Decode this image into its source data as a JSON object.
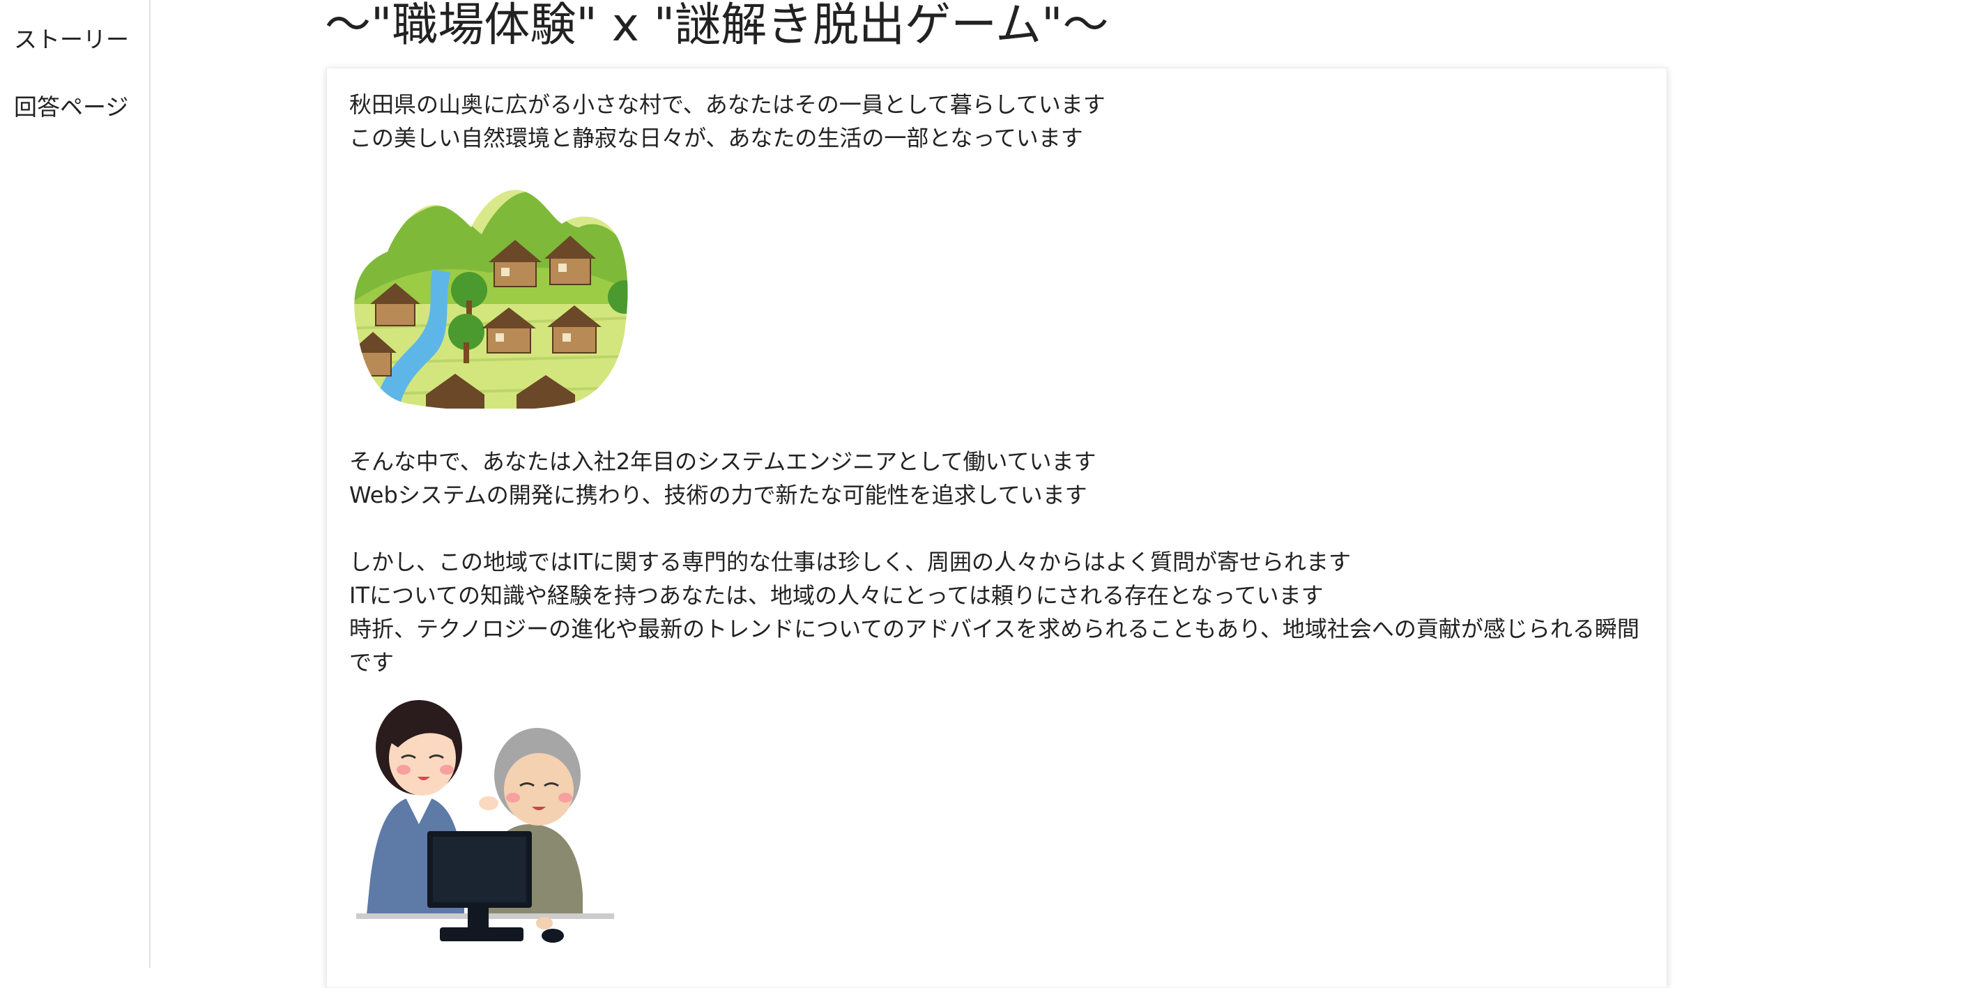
{
  "sidebar": {
    "items": [
      {
        "label": "ストーリー"
      },
      {
        "label": "回答ページ"
      }
    ]
  },
  "header": {
    "title": "〜\"職場体験\" x \"謎解き脱出ゲーム\"〜"
  },
  "story": {
    "paragraph1": [
      "秋田県の山奥に広がる小さな村で、あなたはその一員として暮らしています",
      "この美しい自然環境と静寂な日々が、あなたの生活の一部となっています"
    ],
    "paragraph2": [
      "そんな中で、あなたは入社2年目のシステムエンジニアとして働いています",
      "Webシステムの開発に携わり、技術の力で新たな可能性を追求しています"
    ],
    "paragraph3": [
      "しかし、この地域ではITに関する専門的な仕事は珍しく、周囲の人々からはよく質問が寄せられます",
      "ITについての知識や経験を持つあなたは、地域の人々にとっては頼りにされる存在となっています",
      "時折、テクノロジーの進化や最新のトレンドについてのアドバイスを求められることもあり、地域社会への貢献が感じられる瞬間です"
    ]
  },
  "images": {
    "village": "village-illustration",
    "office": "consultation-illustration"
  }
}
